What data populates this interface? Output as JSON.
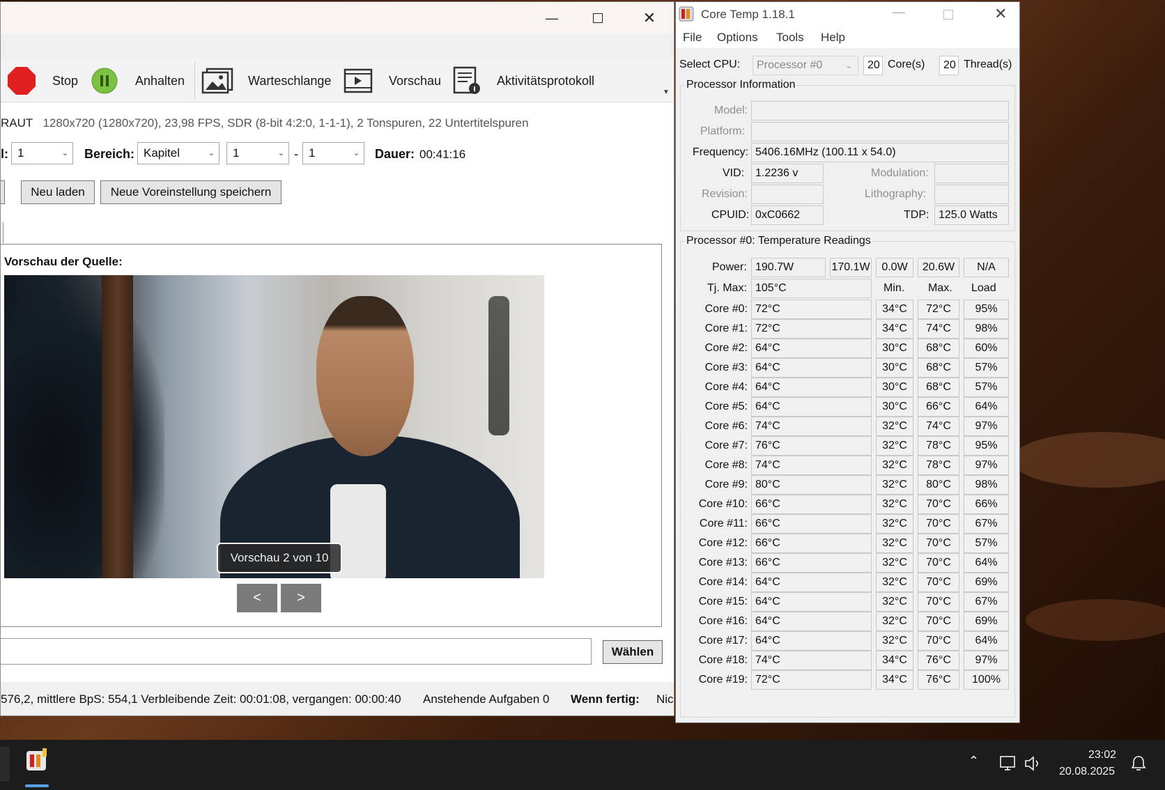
{
  "handbrake": {
    "toolbar": {
      "stop": "Stop",
      "pause": "Anhalten",
      "queue": "Warteschlange",
      "preview": "Vorschau",
      "activity": "Aktivitätsprotokoll"
    },
    "source_info_prefix": "RAUT",
    "source_info": "1280x720 (1280x720), 23,98 FPS, SDR (8-bit 4:2:0, 1-1-1), 2 Tonspuren, 22 Untertitelspuren",
    "title_label_partial": "l:",
    "title_value": "1",
    "range_label": "Bereich:",
    "range_type": "Kapitel",
    "range_from": "1",
    "range_sep": "-",
    "range_to": "1",
    "duration_label": "Dauer:",
    "duration_value": "00:41:16",
    "reload_button": "Neu laden",
    "save_preset_button": "Neue Voreinstellung speichern",
    "source_preview_label": "Vorschau der Quelle:",
    "preview_badge": "Vorschau 2 von 10",
    "prev_button": "<",
    "next_button": ">",
    "browse_button": "Wählen",
    "status_text": "576,2, mittlere BpS: 554,1 Verbleibende Zeit: 00:01:08, vergangen: 00:00:40",
    "pending_tasks": "Anstehende Aufgaben 0",
    "when_done_label": "Wenn fertig:",
    "when_done_value": "Nic"
  },
  "coretemp": {
    "title": "Core Temp 1.18.1",
    "menu": [
      "File",
      "Options",
      "Tools",
      "Help"
    ],
    "select_cpu_label": "Select CPU:",
    "processor_select": "Processor #0",
    "cores_count": "20",
    "cores_label": "Core(s)",
    "threads_count": "20",
    "threads_label": "Thread(s)",
    "proc_info_title": "Processor Information",
    "model_label": "Model:",
    "platform_label": "Platform:",
    "frequency_label": "Frequency:",
    "frequency_value": "5406.16MHz (100.11 x 54.0)",
    "vid_label": "VID:",
    "vid_value": "1.2236 v",
    "modulation_label": "Modulation:",
    "revision_label": "Revision:",
    "lithography_label": "Lithography:",
    "cpuid_label": "CPUID:",
    "cpuid_value": "0xC0662",
    "tdp_label": "TDP:",
    "tdp_value": "125.0 Watts",
    "temp_title": "Processor #0: Temperature Readings",
    "power_label": "Power:",
    "power_values": [
      "190.7W",
      "170.1W",
      "0.0W",
      "20.6W",
      "N/A"
    ],
    "tjmax_label": "Tj. Max:",
    "tjmax_value": "105°C",
    "col_min": "Min.",
    "col_max": "Max.",
    "col_load": "Load",
    "cores": [
      {
        "name": "Core #0:",
        "temp": "72°C",
        "min": "34°C",
        "max": "72°C",
        "load": "95%"
      },
      {
        "name": "Core #1:",
        "temp": "72°C",
        "min": "34°C",
        "max": "74°C",
        "load": "98%"
      },
      {
        "name": "Core #2:",
        "temp": "64°C",
        "min": "30°C",
        "max": "68°C",
        "load": "60%"
      },
      {
        "name": "Core #3:",
        "temp": "64°C",
        "min": "30°C",
        "max": "68°C",
        "load": "57%"
      },
      {
        "name": "Core #4:",
        "temp": "64°C",
        "min": "30°C",
        "max": "68°C",
        "load": "57%"
      },
      {
        "name": "Core #5:",
        "temp": "64°C",
        "min": "30°C",
        "max": "66°C",
        "load": "64%"
      },
      {
        "name": "Core #6:",
        "temp": "74°C",
        "min": "32°C",
        "max": "74°C",
        "load": "97%"
      },
      {
        "name": "Core #7:",
        "temp": "76°C",
        "min": "32°C",
        "max": "78°C",
        "load": "95%"
      },
      {
        "name": "Core #8:",
        "temp": "74°C",
        "min": "32°C",
        "max": "78°C",
        "load": "97%"
      },
      {
        "name": "Core #9:",
        "temp": "80°C",
        "min": "32°C",
        "max": "80°C",
        "load": "98%"
      },
      {
        "name": "Core #10:",
        "temp": "66°C",
        "min": "32°C",
        "max": "70°C",
        "load": "66%"
      },
      {
        "name": "Core #11:",
        "temp": "66°C",
        "min": "32°C",
        "max": "70°C",
        "load": "67%"
      },
      {
        "name": "Core #12:",
        "temp": "66°C",
        "min": "32°C",
        "max": "70°C",
        "load": "57%"
      },
      {
        "name": "Core #13:",
        "temp": "66°C",
        "min": "32°C",
        "max": "70°C",
        "load": "64%"
      },
      {
        "name": "Core #14:",
        "temp": "64°C",
        "min": "32°C",
        "max": "70°C",
        "load": "69%"
      },
      {
        "name": "Core #15:",
        "temp": "64°C",
        "min": "32°C",
        "max": "70°C",
        "load": "67%"
      },
      {
        "name": "Core #16:",
        "temp": "64°C",
        "min": "32°C",
        "max": "70°C",
        "load": "69%"
      },
      {
        "name": "Core #17:",
        "temp": "64°C",
        "min": "32°C",
        "max": "70°C",
        "load": "64%"
      },
      {
        "name": "Core #18:",
        "temp": "74°C",
        "min": "34°C",
        "max": "76°C",
        "load": "97%"
      },
      {
        "name": "Core #19:",
        "temp": "72°C",
        "min": "34°C",
        "max": "76°C",
        "load": "100%"
      }
    ]
  },
  "taskbar": {
    "time": "23:02",
    "date": "20.08.2025"
  },
  "colors": {
    "stop_red": "#e02020",
    "pause_green": "#7dc242",
    "taskbar_bg": "#1c1c1c",
    "taskbar_indicator": "#5aa0e8"
  }
}
